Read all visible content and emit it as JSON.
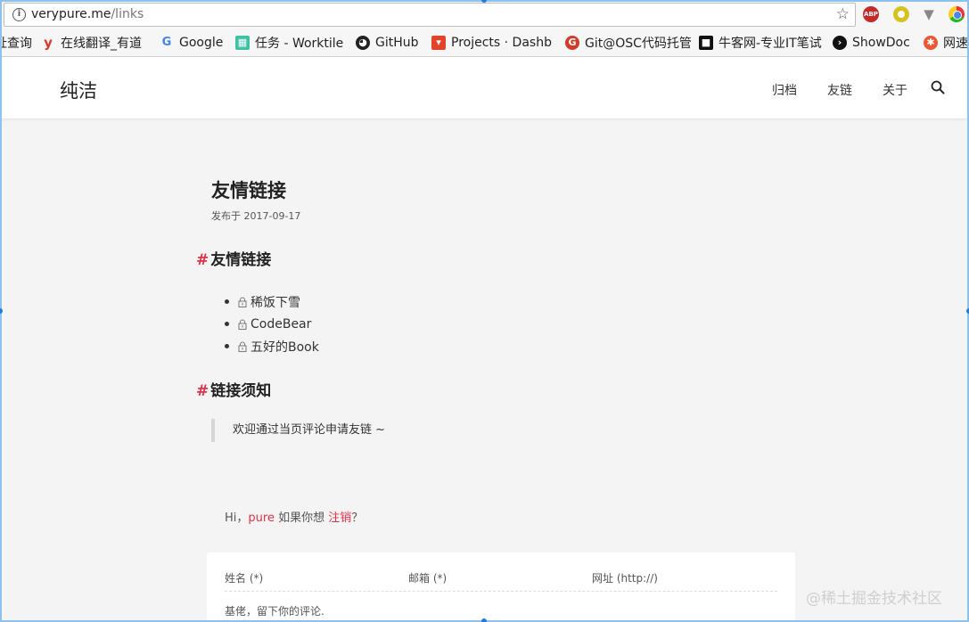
{
  "browser": {
    "url_host": "verypure.me",
    "url_path": "/links",
    "bookmarks": [
      {
        "label": "址查询",
        "icon": "bookmark-icon"
      },
      {
        "label": "在线翻译_有道",
        "icon": "youdao-icon"
      },
      {
        "label": "Google",
        "icon": "google-icon"
      },
      {
        "label": "任务 - Worktile",
        "icon": "worktile-icon"
      },
      {
        "label": "GitHub",
        "icon": "github-icon"
      },
      {
        "label": "Projects · Dashb",
        "icon": "gitlab-icon"
      },
      {
        "label": "Git@OSC代码托管",
        "icon": "osc-icon"
      },
      {
        "label": "牛客网-专业IT笔试",
        "icon": "nowcoder-icon"
      },
      {
        "label": "ShowDoc",
        "icon": "showdoc-icon"
      },
      {
        "label": "网速",
        "icon": "speedtest-icon"
      }
    ],
    "extensions": {
      "abp_label": "ABP"
    }
  },
  "site": {
    "title": "纯洁",
    "nav": [
      "归档",
      "友链",
      "关于"
    ]
  },
  "post": {
    "title": "友情链接",
    "meta": "发布于 2017-09-17",
    "section1_title": "友情链接",
    "links": [
      "稀饭下雪",
      "CodeBear",
      "五好的Book"
    ],
    "section2_title": "链接须知",
    "quote": "欢迎通过当页评论申请友链 ~",
    "hash": "#"
  },
  "comment": {
    "greeting_pre": "Hi，",
    "user": "pure",
    "greeting_mid": " 如果你想 ",
    "logout": "注销",
    "greeting_end": "？",
    "name_label": "姓名 (*)",
    "email_label": "邮箱 (*)",
    "url_label": "网址 (http://)",
    "placeholder": "基佬，留下你的评论."
  },
  "watermark": "@稀土掘金技术社区",
  "colors": {
    "accent": "#e2314a",
    "background": "#f4f4f4"
  }
}
